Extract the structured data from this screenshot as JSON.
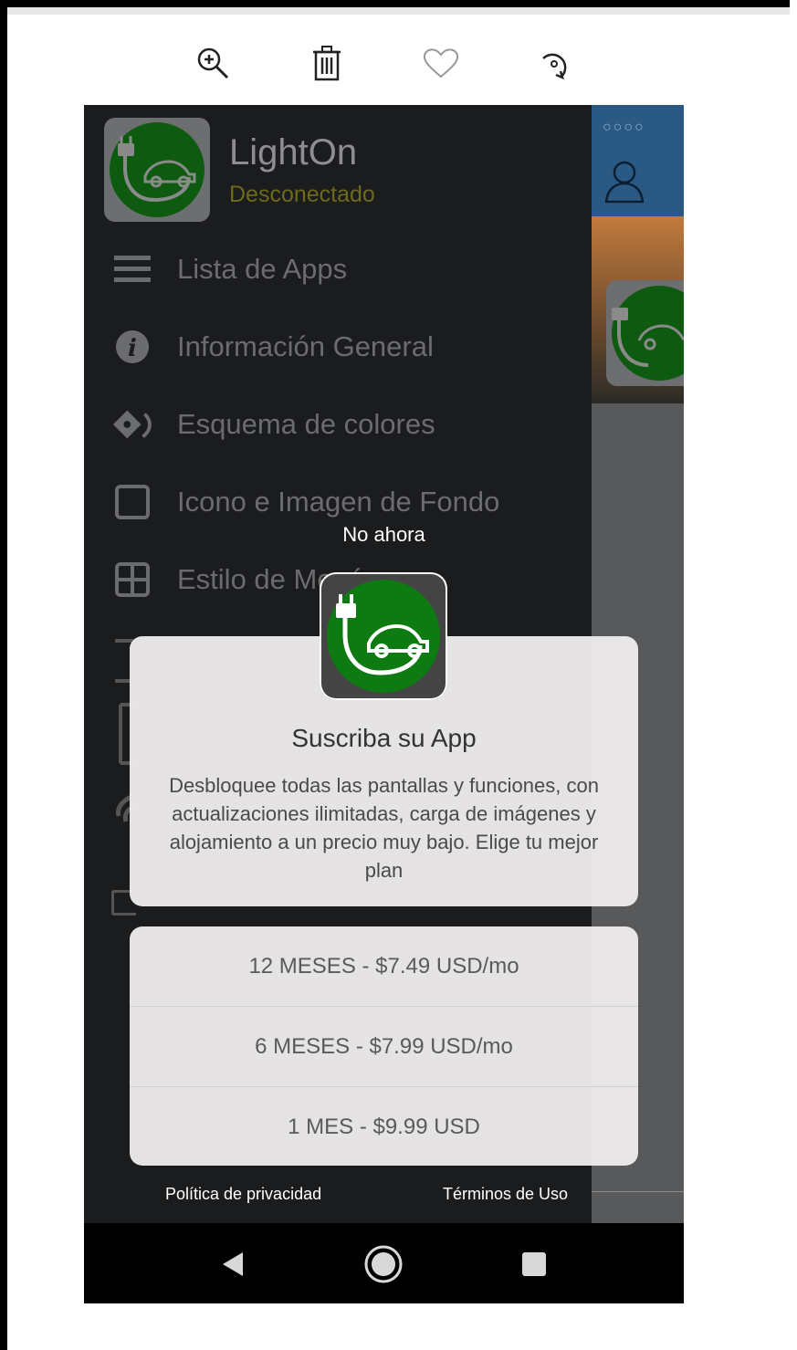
{
  "toolbar": {
    "zoom_icon": "zoom-in-icon",
    "trash_icon": "trash-icon",
    "heart_icon": "heart-icon",
    "rotate_icon": "rotate-icon"
  },
  "app": {
    "name": "LightOn",
    "status": "Desconectado"
  },
  "menu": {
    "items": [
      {
        "label": "Lista de Apps",
        "icon": "hamburger-icon"
      },
      {
        "label": "Información General",
        "icon": "info-icon"
      },
      {
        "label": "Esquema de colores",
        "icon": "paint-bucket-icon"
      },
      {
        "label": "Icono e Imagen de Fondo",
        "icon": "square-icon"
      },
      {
        "label": "Estilo de Menú",
        "icon": "grid-icon"
      }
    ]
  },
  "dialog": {
    "dismiss": "No ahora",
    "title": "Suscriba su App",
    "description": "Desbloquee todas las pantallas y funciones, con actualizaciones ilimitadas, carga de imágenes y alojamiento a un precio muy bajo. Elige tu mejor plan",
    "plans": [
      "12 MESES - $7.49 USD/mo",
      "6 MESES - $7.99 USD/mo",
      "1 MES - $9.99 USD"
    ],
    "privacy": "Política de privacidad",
    "terms": "Términos de Uso"
  },
  "colors": {
    "accent_green": "#0e7a12",
    "status_olive": "#6f6a1b",
    "header_blue": "#2a5a83"
  }
}
